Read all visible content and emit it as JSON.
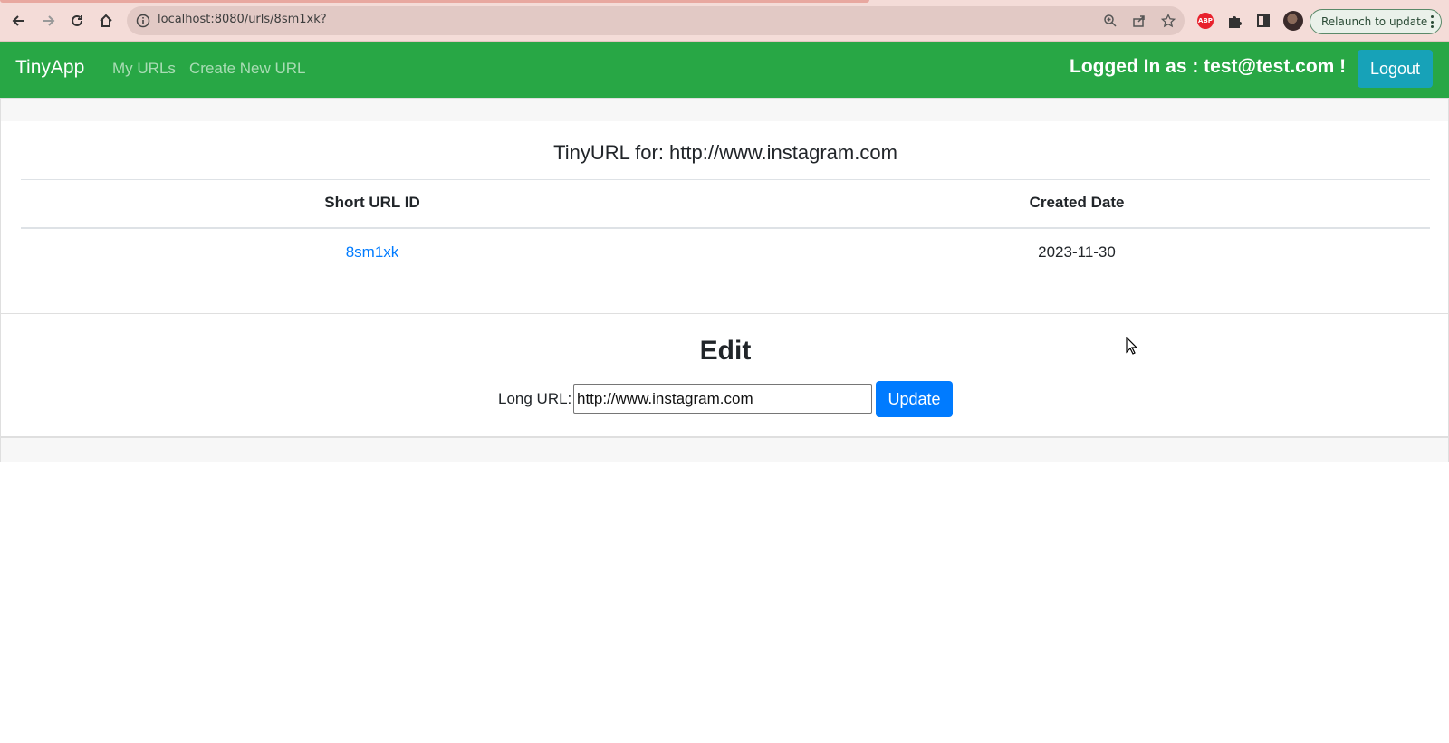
{
  "browser": {
    "url": "localhost:8080/urls/8sm1xk?",
    "relaunch_label": "Relaunch to update",
    "extension_badge": "ABP",
    "icons": [
      "back-icon",
      "forward-icon",
      "reload-icon",
      "home-icon",
      "info-icon",
      "zoom-icon",
      "share-icon",
      "star-icon",
      "puzzle-icon",
      "sidebar-icon",
      "menu-icon"
    ]
  },
  "navbar": {
    "brand": "TinyApp",
    "links": [
      "My URLs",
      "Create New URL"
    ],
    "logged_in_text": "Logged In as : test@test.com !",
    "logout_label": "Logout",
    "color": "#28a745"
  },
  "url_card": {
    "title": "TinyURL for: http://www.instagram.com",
    "headers": [
      "Short URL ID",
      "Created Date"
    ],
    "rows": [
      {
        "short_id": "8sm1xk",
        "created": "2023-11-30"
      }
    ]
  },
  "edit": {
    "title": "Edit",
    "label": "Long URL:",
    "value": "http://www.instagram.com",
    "button_label": "Update",
    "button_color": "#007bff"
  }
}
